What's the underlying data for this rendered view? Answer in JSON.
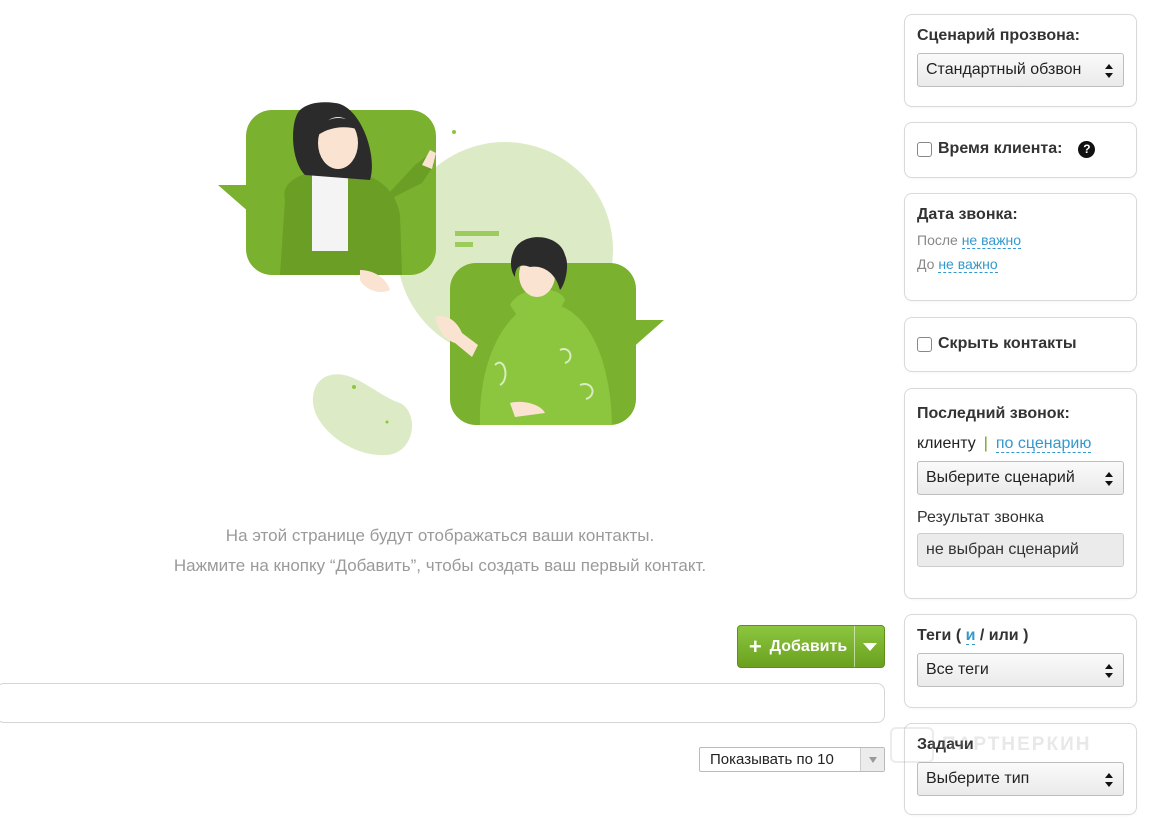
{
  "empty_state": {
    "line1": "На этой странице будут отображаться ваши контакты.",
    "line2": "Нажмите на кнопку “Добавить”, чтобы создать ваш первый контакт."
  },
  "toolbar": {
    "add_label": "Добавить",
    "add_icon": "plus-icon",
    "dropdown_icon": "caret-down-icon"
  },
  "pagination": {
    "page_size_label": "Показывать по 10"
  },
  "sidebar": {
    "scenario": {
      "title": "Сценарий прозвона:",
      "selected": "Стандартный обзвон"
    },
    "client_time": {
      "label": "Время клиента:",
      "help_icon": "question-icon"
    },
    "call_date": {
      "title": "Дата звонка:",
      "after_label": "После",
      "after_value": "не важно",
      "before_label": "До",
      "before_value": "не важно"
    },
    "hide_contacts": {
      "label": "Скрыть контакты"
    },
    "last_call": {
      "title": "Последний звонок:",
      "tab_client": "клиенту",
      "tab_separator": "|",
      "tab_scenario": "по сценарию",
      "scenario_select": "Выберите сценарий",
      "result_label": "Результат звонка",
      "result_value": "не выбран сценарий"
    },
    "tags": {
      "title_prefix": "Теги (",
      "and_link": "и",
      "title_suffix": "/ или )",
      "selected": "Все теги"
    },
    "tasks": {
      "title": "Задачи",
      "selected": "Выберите тип"
    }
  },
  "watermark": {
    "text": "ПАРТНЕРКИН"
  },
  "colors": {
    "accent_green": "#7ab12e",
    "link_blue": "#3399cc",
    "illustration_light": "#d9ebc0"
  }
}
